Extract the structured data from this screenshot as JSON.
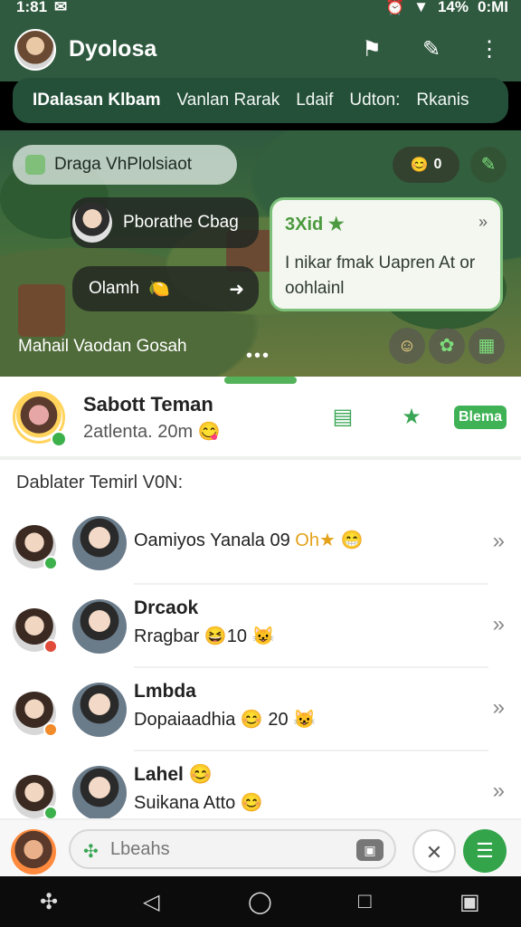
{
  "status": {
    "time": "1:81",
    "battery": "14%",
    "right_tail": "0:MI"
  },
  "header": {
    "title": "Dyolosa"
  },
  "tabs": [
    "IDalasan Klbam",
    "Vanlan Rarak",
    "Ldaif",
    "Udton:",
    "Rkanis"
  ],
  "scene": {
    "pill_label": "Draga VhPlolsiaot",
    "score": "0",
    "chip1_label": "Pborathe Cbag",
    "chip2_label": "Olamh",
    "card_title": "3Xid",
    "card_text": "I nikar fmak Uapren At or oohlainl",
    "caption": "Mahail Vaodan Gosah",
    "dots": "•••"
  },
  "friend": {
    "name": "Sabott Teman",
    "sub": "2atlenta. 20m",
    "badge": "Blema"
  },
  "list": {
    "title": "Dablater Temirl V0N:",
    "items": [
      {
        "name": "",
        "line": "Oamiyos Yanala 09",
        "tag": "Oh★",
        "status_color": "#3cb04a"
      },
      {
        "name": "Drcaok",
        "line": "Rragbar",
        "tag": "10",
        "status_color": "#e04b3a"
      },
      {
        "name": "Lmbda",
        "line": "Dopaiaadhia",
        "tag": "20",
        "status_color": "#f08a2a"
      },
      {
        "name": "Lahel",
        "line": "Suikana Atto",
        "tag": "",
        "status_color": "#3cb04a"
      }
    ]
  },
  "composer": {
    "placeholder": "Lbeahs"
  }
}
